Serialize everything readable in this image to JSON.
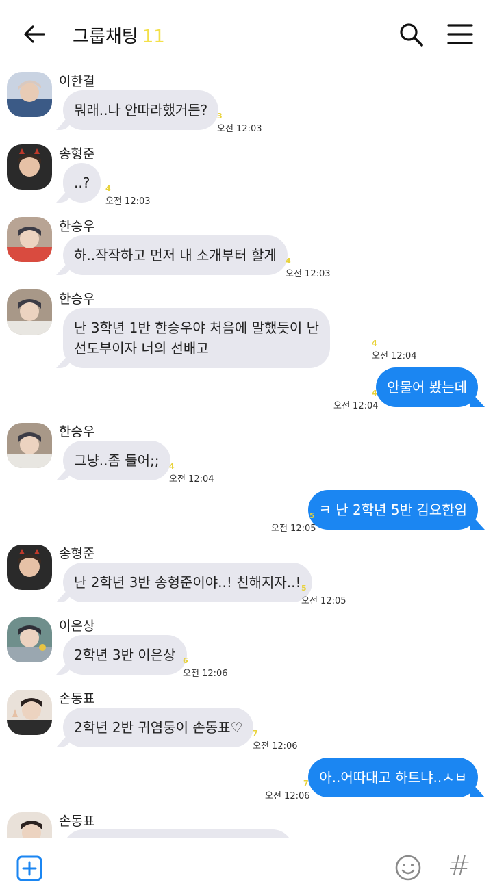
{
  "header": {
    "title": "그룹채팅",
    "member_count": "11"
  },
  "messages": [
    {
      "sender": "이한결",
      "text": "뭐래..나 안따라했거든?",
      "unread": "3",
      "time": "오전 12:03"
    },
    {
      "sender": "송형준",
      "text": "..?",
      "unread": "4",
      "time": "오전 12:03"
    },
    {
      "sender": "한승우",
      "text": "하..작작하고 먼저 내 소개부터 할게",
      "unread": "4",
      "time": "오전 12:03"
    },
    {
      "sender": "한승우",
      "line1": "난 3학년 1반 한승우야 처음에 말했듯이 난",
      "line2": "선도부이자 너의 선배고",
      "unread": "4",
      "time": "오전 12:04"
    },
    {
      "outgoing": true,
      "text": "안물어 봤는데",
      "unread": "4",
      "time": "오전 12:04"
    },
    {
      "sender": "한승우",
      "text": "그냥..좀 들어;;",
      "unread": "4",
      "time": "오전 12:04"
    },
    {
      "outgoing": true,
      "text": "ㅋ 난 2학년 5반 김요한임",
      "unread": "5",
      "time": "오전 12:05"
    },
    {
      "sender": "송형준",
      "text": "난 2학년 3반 송형준이야..! 친해지자..!",
      "unread": "5",
      "time": "오전 12:05"
    },
    {
      "sender": "이은상",
      "text": "2학년 3반 이은상",
      "unread": "6",
      "time": "오전 12:06"
    },
    {
      "sender": "손동표",
      "text": "2학년 2반 귀염둥이 손동표♡",
      "unread": "7",
      "time": "오전 12:06"
    },
    {
      "outgoing": true,
      "text": "아..어따대고 하트냐..ㅅㅂ",
      "unread": "7",
      "time": "오전 12:06"
    },
    {
      "sender": "손동표"
    }
  ],
  "icons": {
    "back": "back-arrow-icon",
    "search": "search-icon",
    "menu": "hamburger-menu-icon",
    "add": "add-plus-icon",
    "emoji": "emoji-smile-icon",
    "hash": "#"
  },
  "colors": {
    "outgoing_bubble": "#1b86f2",
    "incoming_bubble": "#e7e7ee",
    "unread": "#e8d23a",
    "count": "#f3e04a"
  }
}
